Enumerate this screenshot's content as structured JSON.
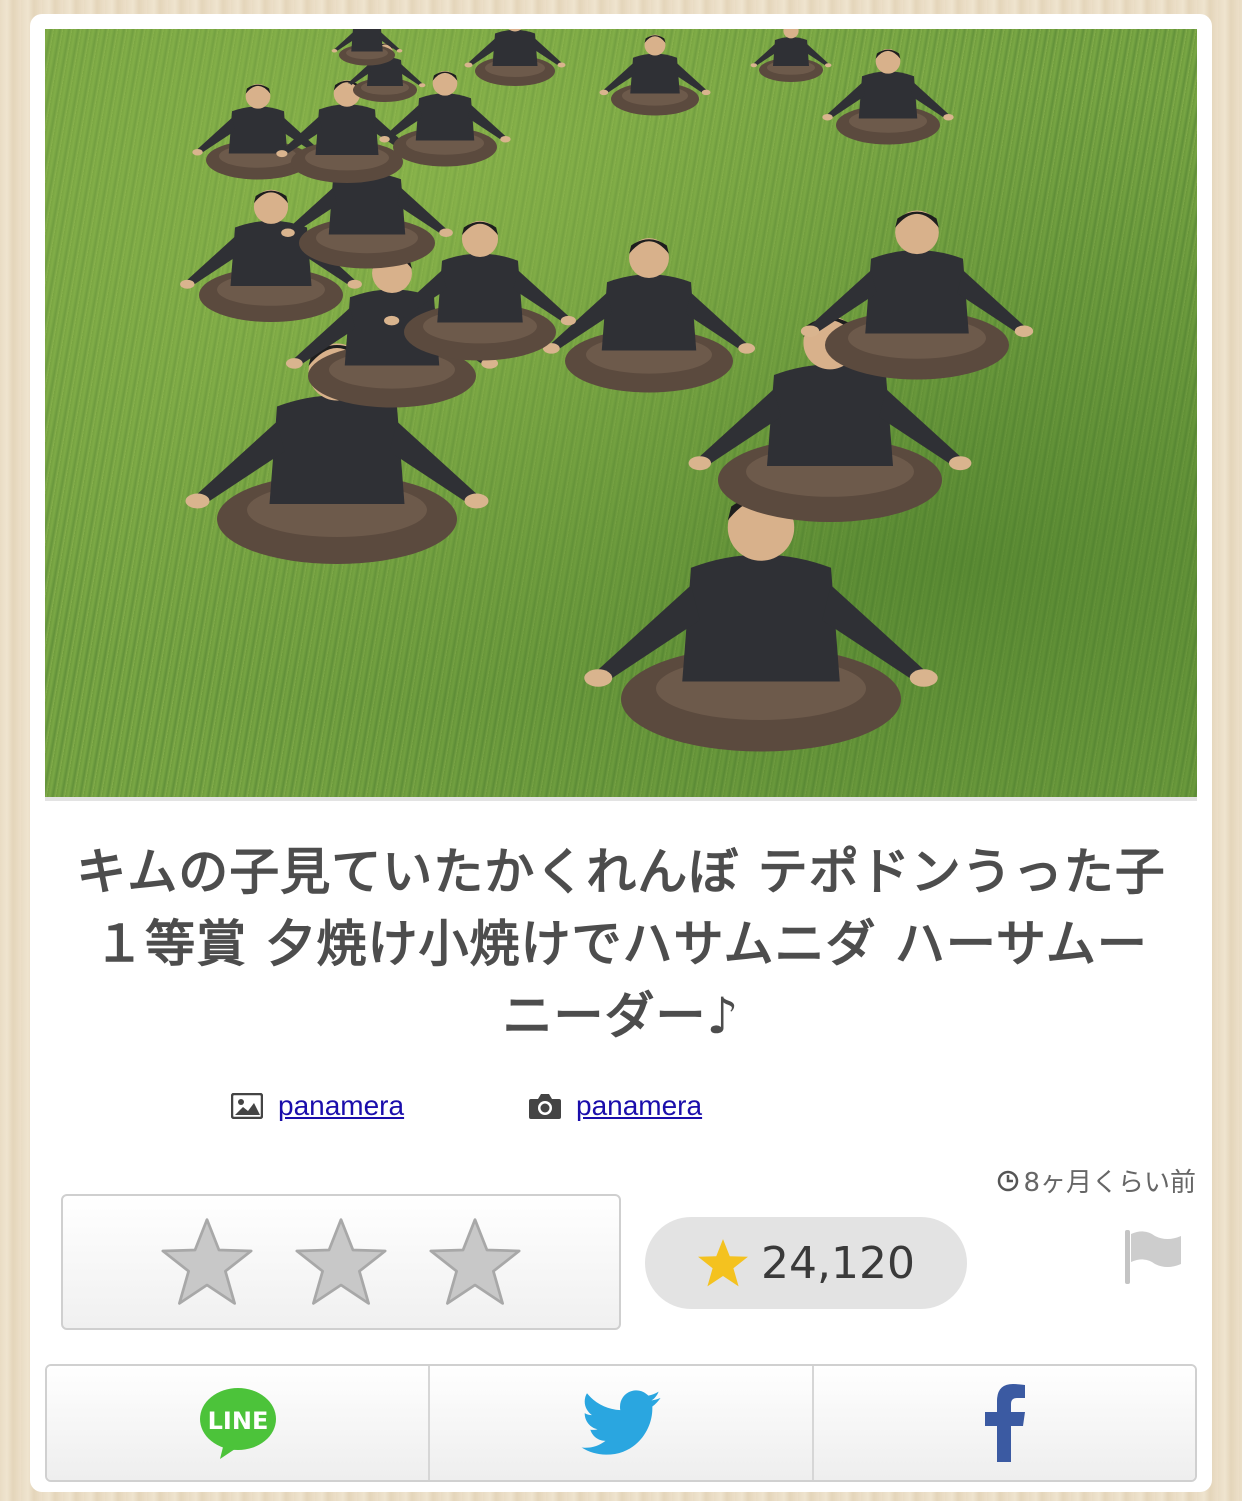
{
  "post": {
    "title": "キムの子見ていたかくれんぼ テポドンうった子１等賞 夕焼け小焼けでハサムニダ ハーサムーニーダー♪",
    "image_author": "panamera",
    "photo_author": "panamera",
    "posted_time": "8ヶ月くらい前",
    "score": "24,120"
  },
  "rating": {
    "stars": 3,
    "selected": 0
  },
  "share": {
    "line_label": "LINE",
    "buttons": [
      "line-icon",
      "twitter-icon",
      "facebook-icon"
    ]
  },
  "icons": {
    "image": "image-icon",
    "camera": "camera-icon",
    "clock": "clock-icon",
    "flag": "flag-icon"
  },
  "colors": {
    "link": "#1a0dab",
    "star_gold": "#f4c21f",
    "line_green": "#4cc33a",
    "twitter_blue": "#2aa6e0",
    "facebook_blue": "#3b5aa2"
  }
}
